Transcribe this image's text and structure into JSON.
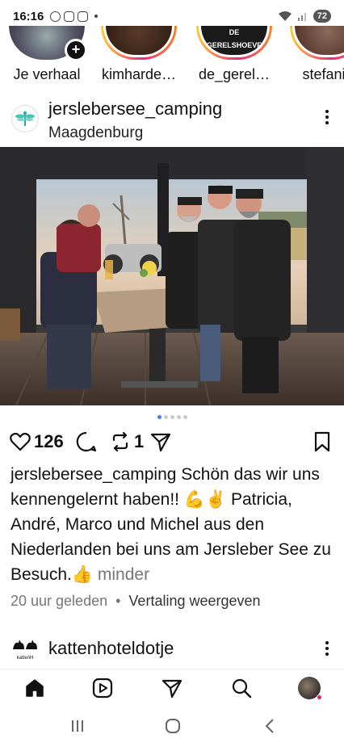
{
  "status_bar": {
    "time": "16:16",
    "battery": "72"
  },
  "stories": [
    {
      "label": "Je verhaal",
      "icon": "add-story-icon"
    },
    {
      "label": "kimharde…"
    },
    {
      "label": "de_gerel…",
      "pic_text": "DE GERELSHOEVE"
    },
    {
      "label": "stefanie"
    }
  ],
  "post": {
    "username": "jerslebersee_camping",
    "location": "Maagdenburg",
    "likes": "126",
    "reposts": "1",
    "caption_user": "jerslebersee_camping",
    "caption_text": "Schön das wir uns kennengelernt haben!! 💪✌️ Patricia, André, Marco und Michel aus den Niederlanden bei uns am Jersleber See zu Besuch.👍",
    "caption_more": "minder",
    "time": "20 uur geleden",
    "separator": "•",
    "translate": "Vertaling weergeven"
  },
  "next_post": {
    "username": "kattenhoteldotje",
    "avatar_text": "kattenH"
  },
  "colors": {
    "accent": "#3b82f6",
    "story_ring_start": "#f9ce34",
    "story_ring_mid": "#ee2a7b",
    "notification": "#e0245e"
  }
}
